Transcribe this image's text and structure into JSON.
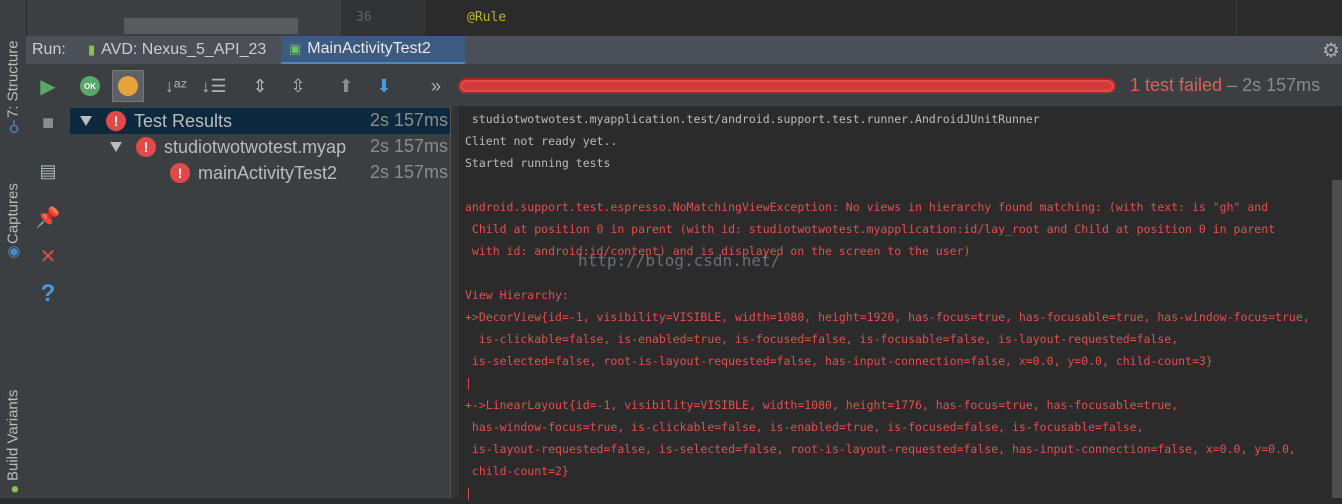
{
  "editor": {
    "line_number": "36",
    "code": "@Rule"
  },
  "left_strip": {
    "tabs": [
      "7: Structure",
      "Captures",
      "Build Variants"
    ]
  },
  "run_bar": {
    "label": "Run:",
    "tabs": [
      "AVD: Nexus_5_API_23",
      "MainActivityTest2"
    ]
  },
  "toolbar": {
    "status_failed": "1 test failed",
    "status_time": " – 2s 157ms",
    "progress": 1.0,
    "ok_badge": "OK"
  },
  "tree": {
    "rows": [
      {
        "label": "Test Results",
        "time": "2s 157ms"
      },
      {
        "label": "studiotwotwotest.myap",
        "time": "2s 157ms"
      },
      {
        "label": "mainActivityTest2",
        "time": "2s 157ms"
      }
    ]
  },
  "console": {
    "lines": [
      " studiotwotwotest.myapplication.test/android.support.test.runner.AndroidJUnitRunner",
      "Client not ready yet..",
      "Started running tests",
      "",
      "android.support.test.espresso.NoMatchingViewException: No views in hierarchy found matching: (with text: is \"gh\" and",
      " Child at position 0 in parent (with id: studiotwotwotest.myapplication:id/lay_root and Child at position 0 in parent",
      " with id: android:id/content) and is displayed on the screen to the user)",
      "",
      "View Hierarchy:",
      "+>DecorView{id=-1, visibility=VISIBLE, width=1080, height=1920, has-focus=true, has-focusable=true, has-window-focus=true,",
      "  is-clickable=false, is-enabled=true, is-focused=false, is-focusable=false, is-layout-requested=false,",
      " is-selected=false, root-is-layout-requested=false, has-input-connection=false, x=0.0, y=0.0, child-count=3}",
      "|",
      "+->LinearLayout{id=-1, visibility=VISIBLE, width=1080, height=1776, has-focus=true, has-focusable=true,",
      " has-window-focus=true, is-clickable=false, is-enabled=true, is-focused=false, is-focusable=false,",
      " is-layout-requested=false, is-selected=false, root-is-layout-requested=false, has-input-connection=false, x=0.0, y=0.0,",
      " child-count=2}",
      "|"
    ],
    "watermark": "http://blog.csdn.net/"
  },
  "colors": {
    "error": "#e05050",
    "accent": "#4a88c7",
    "run_green": "#59a869"
  }
}
